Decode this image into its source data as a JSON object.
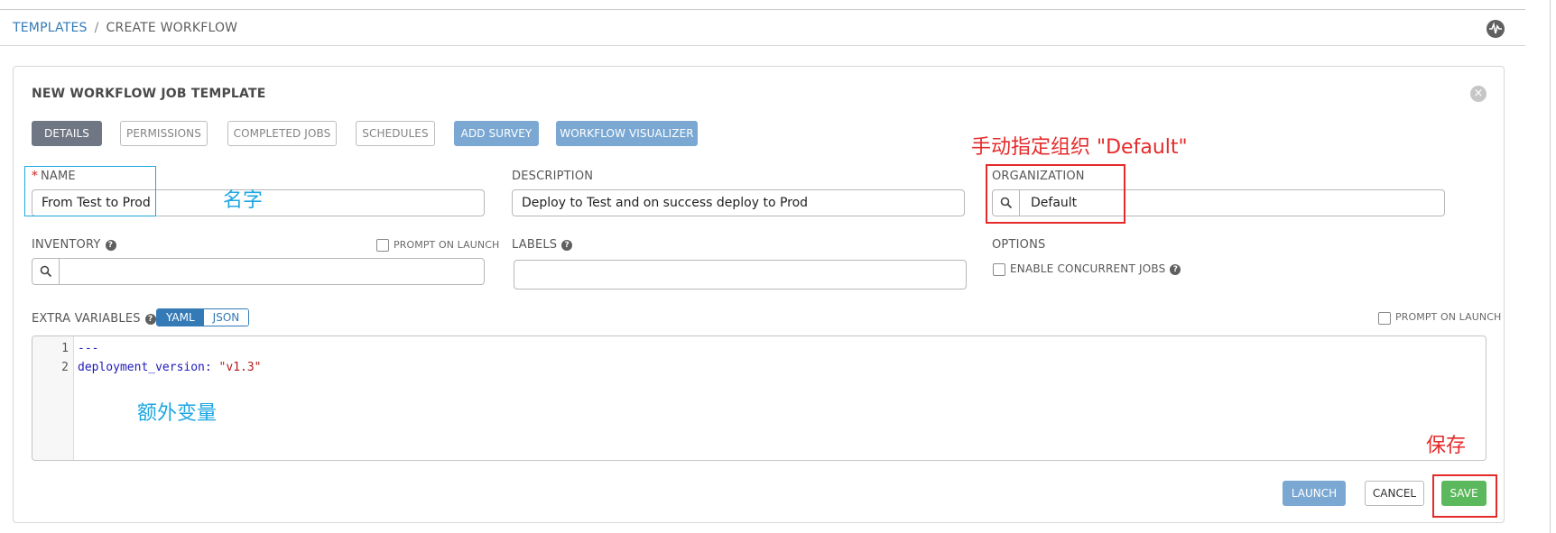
{
  "breadcrumb": {
    "link": "TEMPLATES",
    "separator": "/",
    "current": "CREATE WORKFLOW"
  },
  "header": {
    "activity_icon": "activity-stream-icon"
  },
  "card": {
    "title": "NEW WORKFLOW JOB TEMPLATE",
    "close_icon": "close-icon"
  },
  "tabs": [
    {
      "label": "DETAILS",
      "state": "active"
    },
    {
      "label": "PERMISSIONS",
      "state": "disabled"
    },
    {
      "label": "COMPLETED JOBS",
      "state": "disabled"
    },
    {
      "label": "SCHEDULES",
      "state": "disabled"
    },
    {
      "label": "ADD SURVEY",
      "state": "primary"
    },
    {
      "label": "WORKFLOW VISUALIZER",
      "state": "primary"
    }
  ],
  "form": {
    "name": {
      "required_mark": "*",
      "label": "NAME",
      "value": "From Test to Prod"
    },
    "description": {
      "label": "DESCRIPTION",
      "value": "Deploy to Test and on success deploy to Prod"
    },
    "organization": {
      "label": "ORGANIZATION",
      "value": "Default"
    },
    "inventory": {
      "label": "INVENTORY",
      "help": "?",
      "prompt_on_launch": "PROMPT ON LAUNCH",
      "value": ""
    },
    "labels": {
      "label": "LABELS",
      "help": "?",
      "value": ""
    },
    "options": {
      "label": "OPTIONS",
      "concurrent_jobs": "ENABLE CONCURRENT JOBS",
      "help": "?"
    },
    "extra_variables": {
      "label": "EXTRA VARIABLES",
      "help": "?",
      "toggle": [
        "YAML",
        "JSON"
      ],
      "selected": "YAML",
      "prompt_on_launch": "PROMPT ON LAUNCH",
      "lines": [
        {
          "number": "1",
          "text": "---"
        },
        {
          "number": "2",
          "key": "deployment_version",
          "colon": ": ",
          "value": "\"v1.3\""
        }
      ]
    }
  },
  "actions": {
    "launch": "LAUNCH",
    "cancel": "CANCEL",
    "save": "SAVE"
  },
  "annotations": {
    "name_note": "名字",
    "org_note": "手动指定组织 \"Default\"",
    "extra_vars_note": "额外变量",
    "save_note": "保存",
    "colors": {
      "blue": "#1ea7e1",
      "red": "#e52a2a"
    }
  },
  "colors": {
    "link": "#337ab7",
    "tab_active": "#707784",
    "primary_light": "#7aa8d3",
    "success": "#5cb85c"
  }
}
